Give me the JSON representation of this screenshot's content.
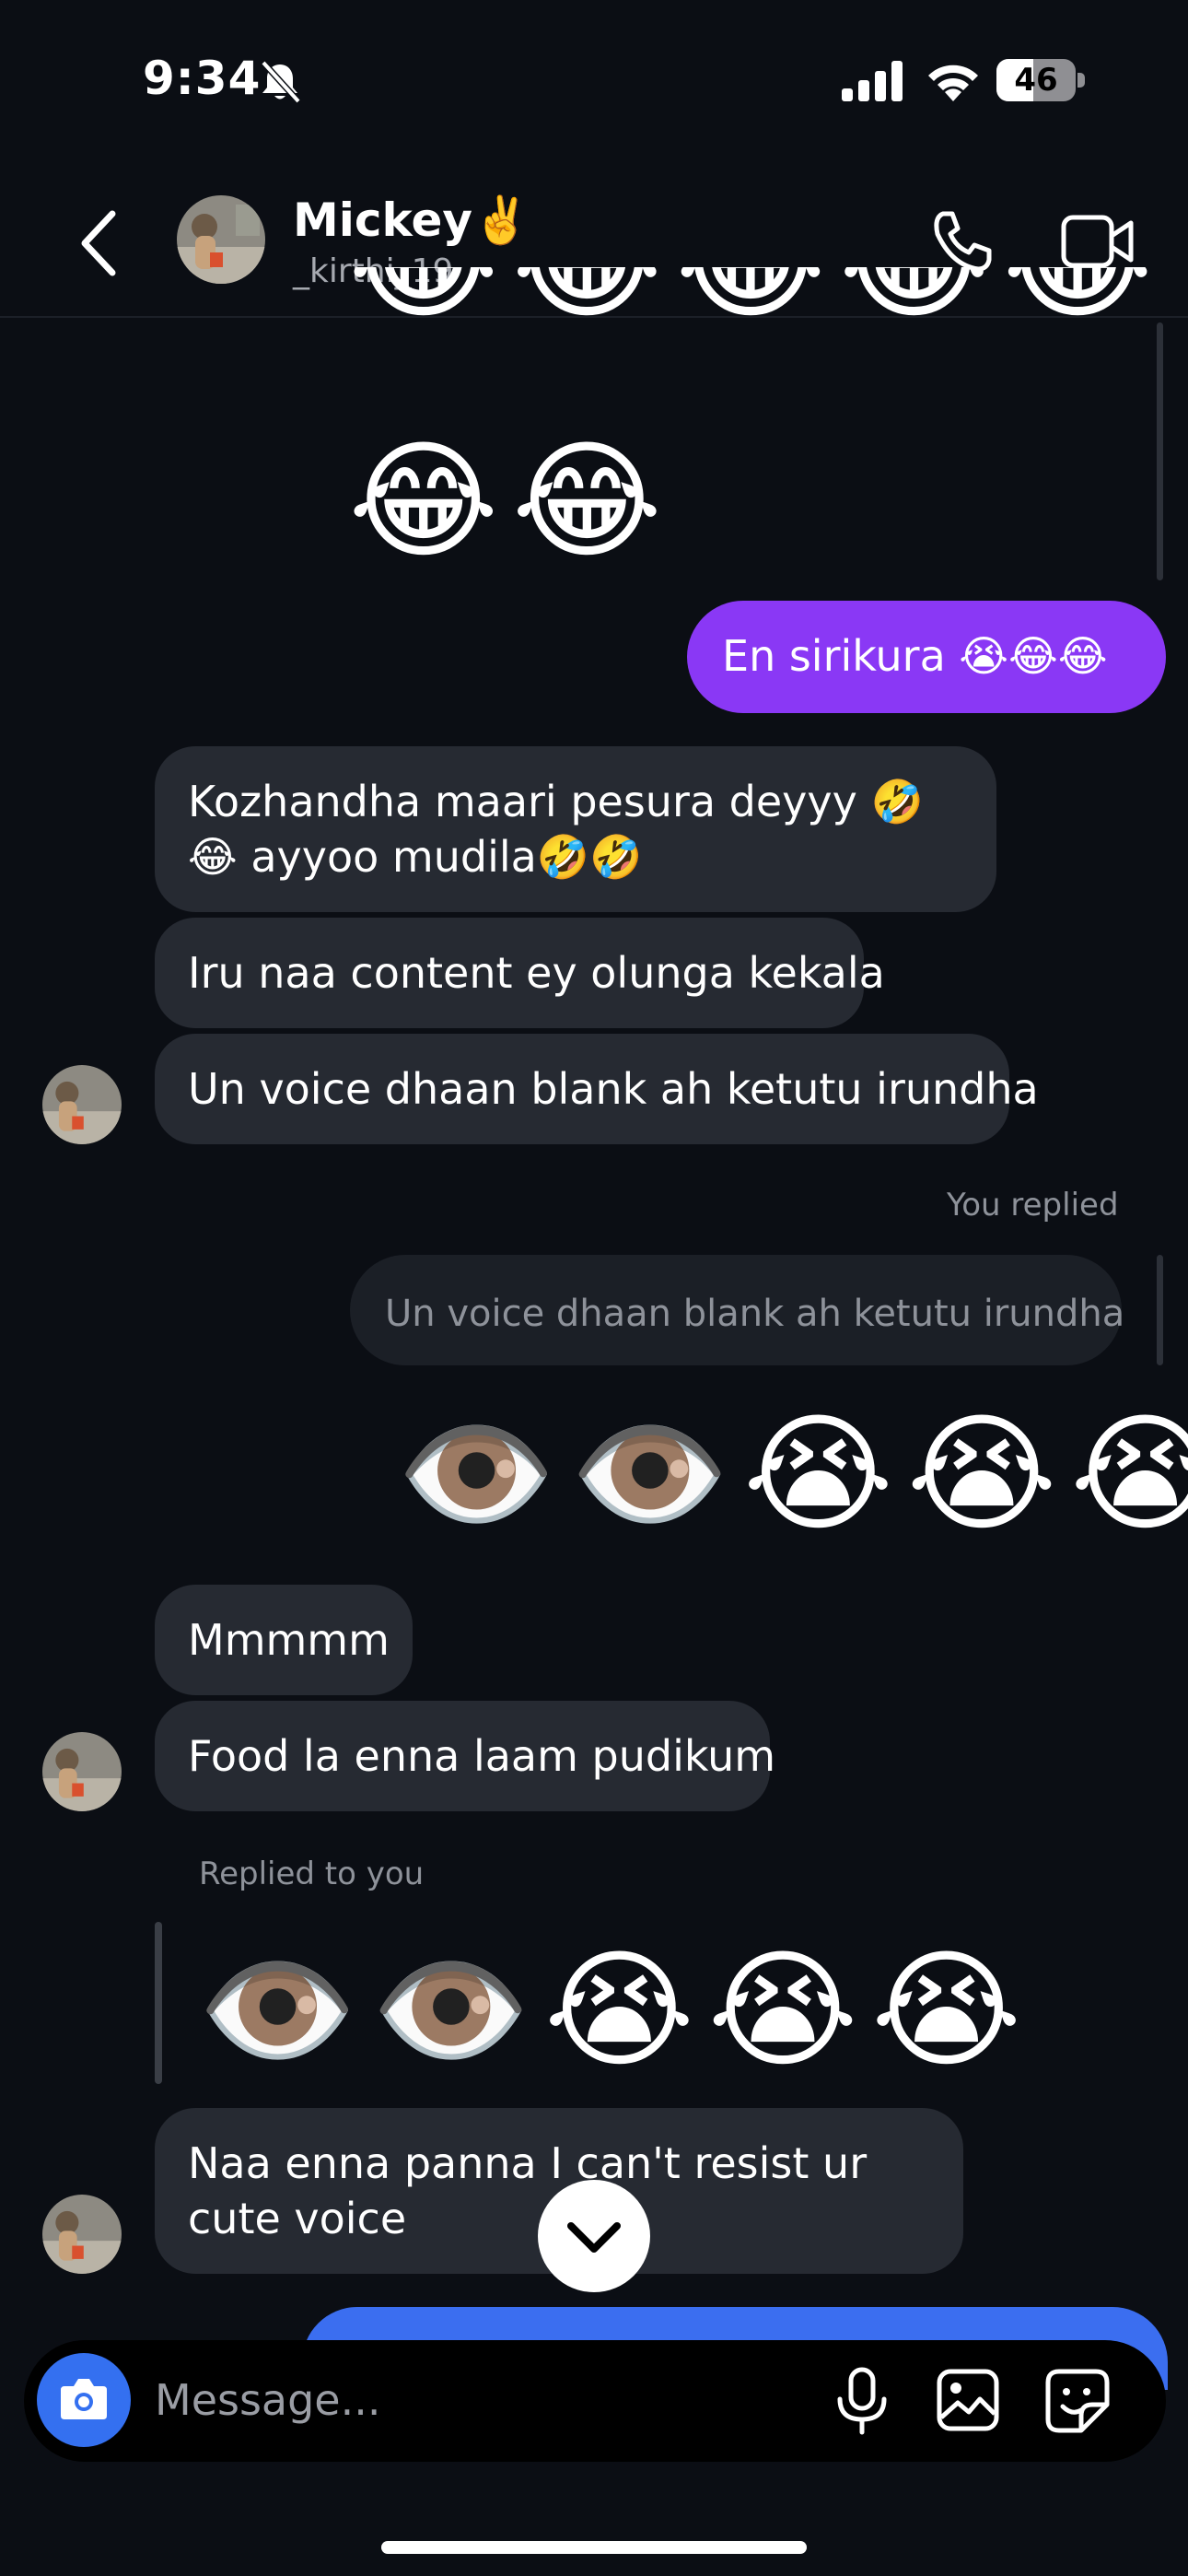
{
  "status_bar": {
    "time": "9:34",
    "battery": "46",
    "battery_fraction": 0.46,
    "icons": [
      "bell-slash-icon",
      "signal-icon",
      "wifi-icon",
      "battery-icon"
    ]
  },
  "header": {
    "name": "Mickey✌️",
    "username": "_kirthi_19",
    "icons": [
      "back-chevron-icon",
      "phone-call-icon",
      "video-call-icon"
    ]
  },
  "messages": {
    "emoji_row_1": [
      "😂",
      "😂",
      "😂",
      "😂",
      "😂"
    ],
    "emoji_row_2": [
      "😂",
      "😂"
    ],
    "out_1": "En sirikura 😭😂😂",
    "in_1": "Kozhandha maari pesura deyyy 🤣😂 ayyoo mudila🤣🤣",
    "in_2": "Iru naa content ey olunga kekala",
    "in_3": "Un voice dhaan blank ah ketutu irundha",
    "you_replied_label": "You replied",
    "replied_quote": "Un voice dhaan blank ah ketutu irundha",
    "out_emojis": [
      "👁️",
      "👁️",
      "😭",
      "😭",
      "😭"
    ],
    "in_4": "Mmmmm",
    "in_5": "Food la enna laam pudikum",
    "replied_to_you_label": "Replied to you",
    "in_emojis": [
      "👁️",
      "👁️",
      "😭",
      "😭",
      "😭"
    ],
    "in_6": "Naa enna panna I can't resist ur cute voice"
  },
  "composer": {
    "placeholder": "Message...",
    "icons": [
      "camera-icon",
      "microphone-icon",
      "gallery-icon",
      "sticker-icon"
    ]
  },
  "colors": {
    "background": "#0b0e14",
    "incoming_bubble": "#262a32",
    "outgoing_bubble": "#8a38f5",
    "camera_button": "#3470f0",
    "peek_bubble": "#3b6ef0"
  }
}
